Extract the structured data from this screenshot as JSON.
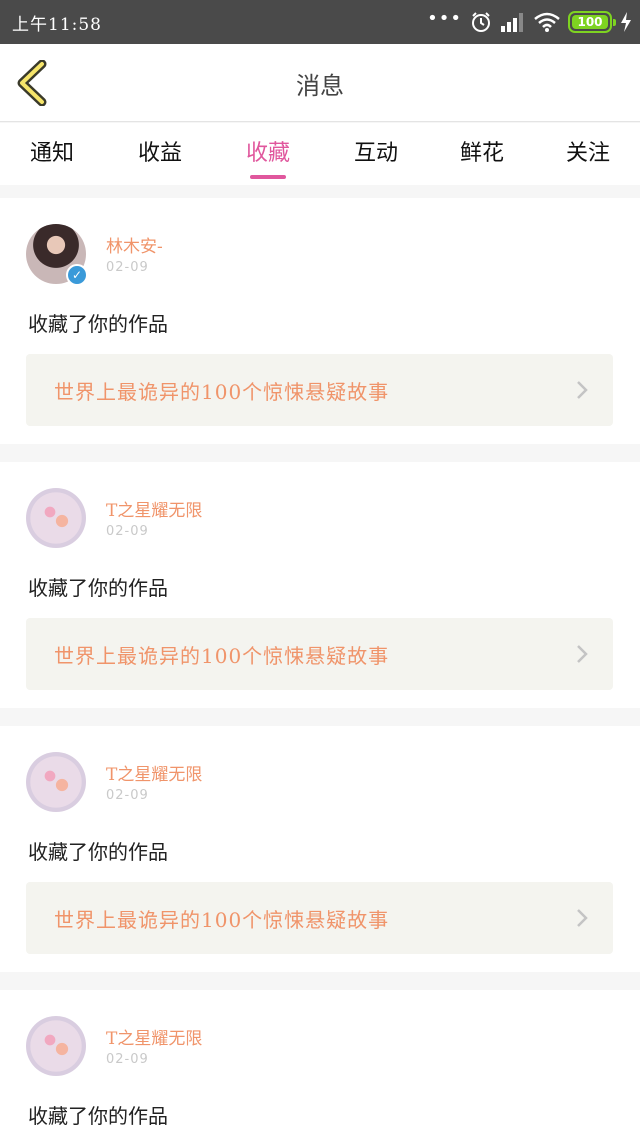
{
  "status_bar": {
    "time": "上午11:58",
    "battery": "100"
  },
  "header": {
    "title": "消息"
  },
  "tabs": [
    {
      "label": "通知",
      "active": false
    },
    {
      "label": "收益",
      "active": false
    },
    {
      "label": "收藏",
      "active": true
    },
    {
      "label": "互动",
      "active": false
    },
    {
      "label": "鲜花",
      "active": false
    },
    {
      "label": "关注",
      "active": false
    }
  ],
  "feed": [
    {
      "user": "林木安-",
      "date": "02-09",
      "verified": true,
      "avatar": "photo",
      "action": "收藏了你的作品",
      "work_title": "世界上最诡异的100个惊悚悬疑故事"
    },
    {
      "user": "T之星耀无限",
      "date": "02-09",
      "verified": false,
      "avatar": "flower",
      "action": "收藏了你的作品",
      "work_title": "世界上最诡异的100个惊悚悬疑故事"
    },
    {
      "user": "T之星耀无限",
      "date": "02-09",
      "verified": false,
      "avatar": "flower",
      "action": "收藏了你的作品",
      "work_title": "世界上最诡异的100个惊悚悬疑故事"
    },
    {
      "user": "T之星耀无限",
      "date": "02-09",
      "verified": false,
      "avatar": "flower",
      "action": "收藏了你的作品",
      "work_title": ""
    }
  ],
  "colors": {
    "accent": "#e0579d",
    "name": "#f0946a",
    "status_bar": "#4a4a4a",
    "battery": "#7ed321",
    "verified": "#3a9ad9"
  },
  "icons": {
    "back": "chevron-left-icon",
    "alarm": "alarm-icon",
    "signal": "signal-icon",
    "wifi": "wifi-icon",
    "charging": "bolt-icon",
    "verified": "verified-badge-icon",
    "more": "chevron-right-icon"
  }
}
